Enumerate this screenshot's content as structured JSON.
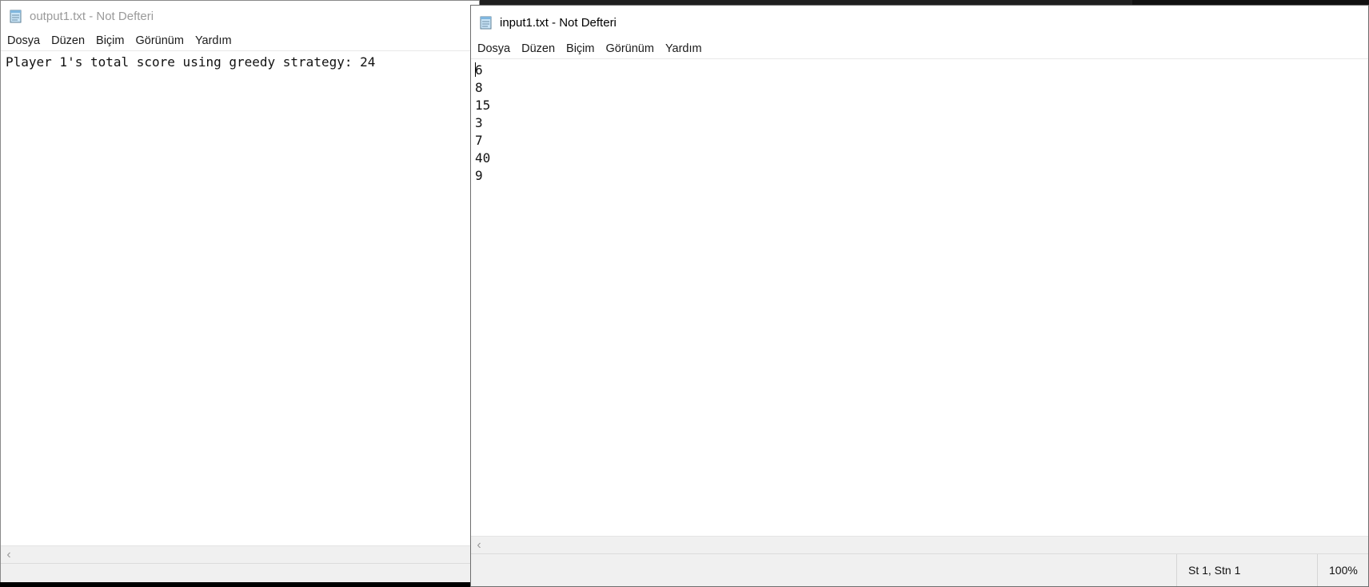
{
  "windows": {
    "output": {
      "title": "output1.txt - Not Defteri",
      "menu": [
        "Dosya",
        "Düzen",
        "Biçim",
        "Görünüm",
        "Yardım"
      ],
      "lines": [
        "Player 1's total score using greedy strategy: 24"
      ]
    },
    "input": {
      "title": "input1.txt - Not Defteri",
      "menu": [
        "Dosya",
        "Düzen",
        "Biçim",
        "Görünüm",
        "Yardım"
      ],
      "lines": [
        "6",
        "8",
        "15",
        "3",
        "7",
        "40",
        "9"
      ],
      "status": {
        "position": "St 1, Stn 1",
        "zoom": "100%"
      }
    }
  },
  "icons": {
    "app": "notepad-icon",
    "scroll_left": "chevron-left-icon"
  },
  "colors": {
    "inactive_title": "#9a9a9a",
    "background": "#ffffff",
    "statusbar": "#f0f0f0"
  }
}
